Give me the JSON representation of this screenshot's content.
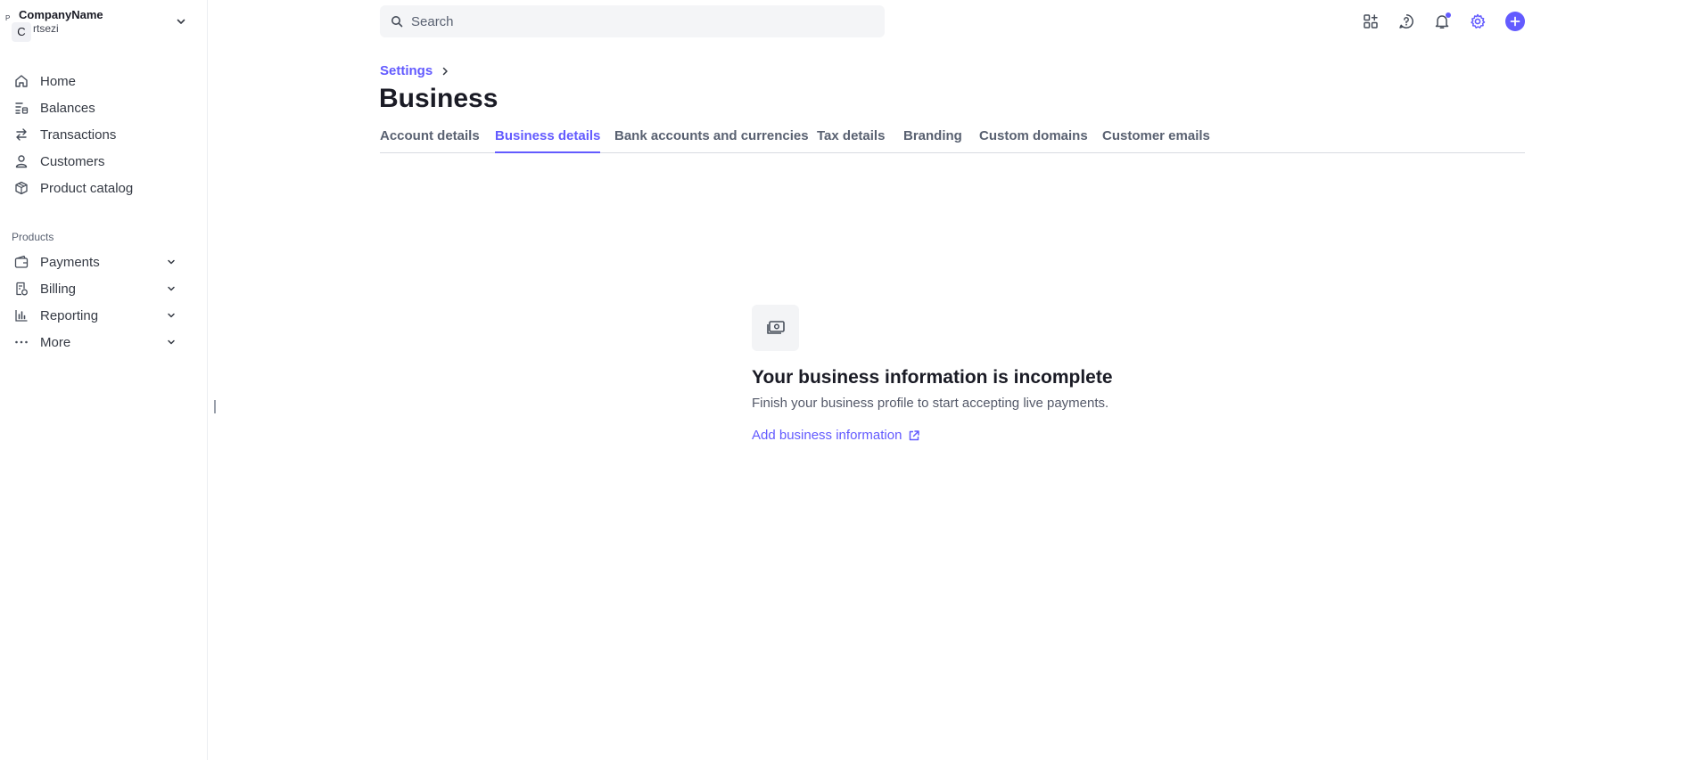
{
  "account": {
    "avatar_letter": "C",
    "mini_letter": "P",
    "name": "CompanyName",
    "subtitle": "rtsezi"
  },
  "sidebar": {
    "items": [
      {
        "label": "Home",
        "icon": "home-icon"
      },
      {
        "label": "Balances",
        "icon": "balances-icon"
      },
      {
        "label": "Transactions",
        "icon": "transactions-icon"
      },
      {
        "label": "Customers",
        "icon": "customers-icon"
      },
      {
        "label": "Product catalog",
        "icon": "product-catalog-icon"
      }
    ],
    "section_label": "Products",
    "product_items": [
      {
        "label": "Payments",
        "icon": "payments-icon"
      },
      {
        "label": "Billing",
        "icon": "billing-icon"
      },
      {
        "label": "Reporting",
        "icon": "reporting-icon"
      },
      {
        "label": "More",
        "icon": "more-dots-icon"
      }
    ]
  },
  "search": {
    "placeholder": "Search"
  },
  "topbar": {
    "icons": [
      "apps-icon",
      "help-icon",
      "notifications-icon",
      "settings-icon",
      "create-plus-icon"
    ]
  },
  "breadcrumb": {
    "parent": "Settings"
  },
  "page": {
    "title": "Business"
  },
  "tabs": [
    {
      "label": "Account details",
      "active": false
    },
    {
      "label": "Business details",
      "active": true
    },
    {
      "label": "Bank accounts and currencies",
      "active": false
    },
    {
      "label": "Tax details",
      "active": false
    },
    {
      "label": "Branding",
      "active": false
    },
    {
      "label": "Custom domains",
      "active": false
    },
    {
      "label": "Customer emails",
      "active": false
    }
  ],
  "empty_state": {
    "icon": "cash-icon",
    "title": "Your business information is incomplete",
    "description": "Finish your business profile to start accepting live payments.",
    "link_label": "Add business information"
  },
  "colors": {
    "accent": "#635bff",
    "text_primary": "#1a1b25",
    "text_secondary": "#596171"
  }
}
